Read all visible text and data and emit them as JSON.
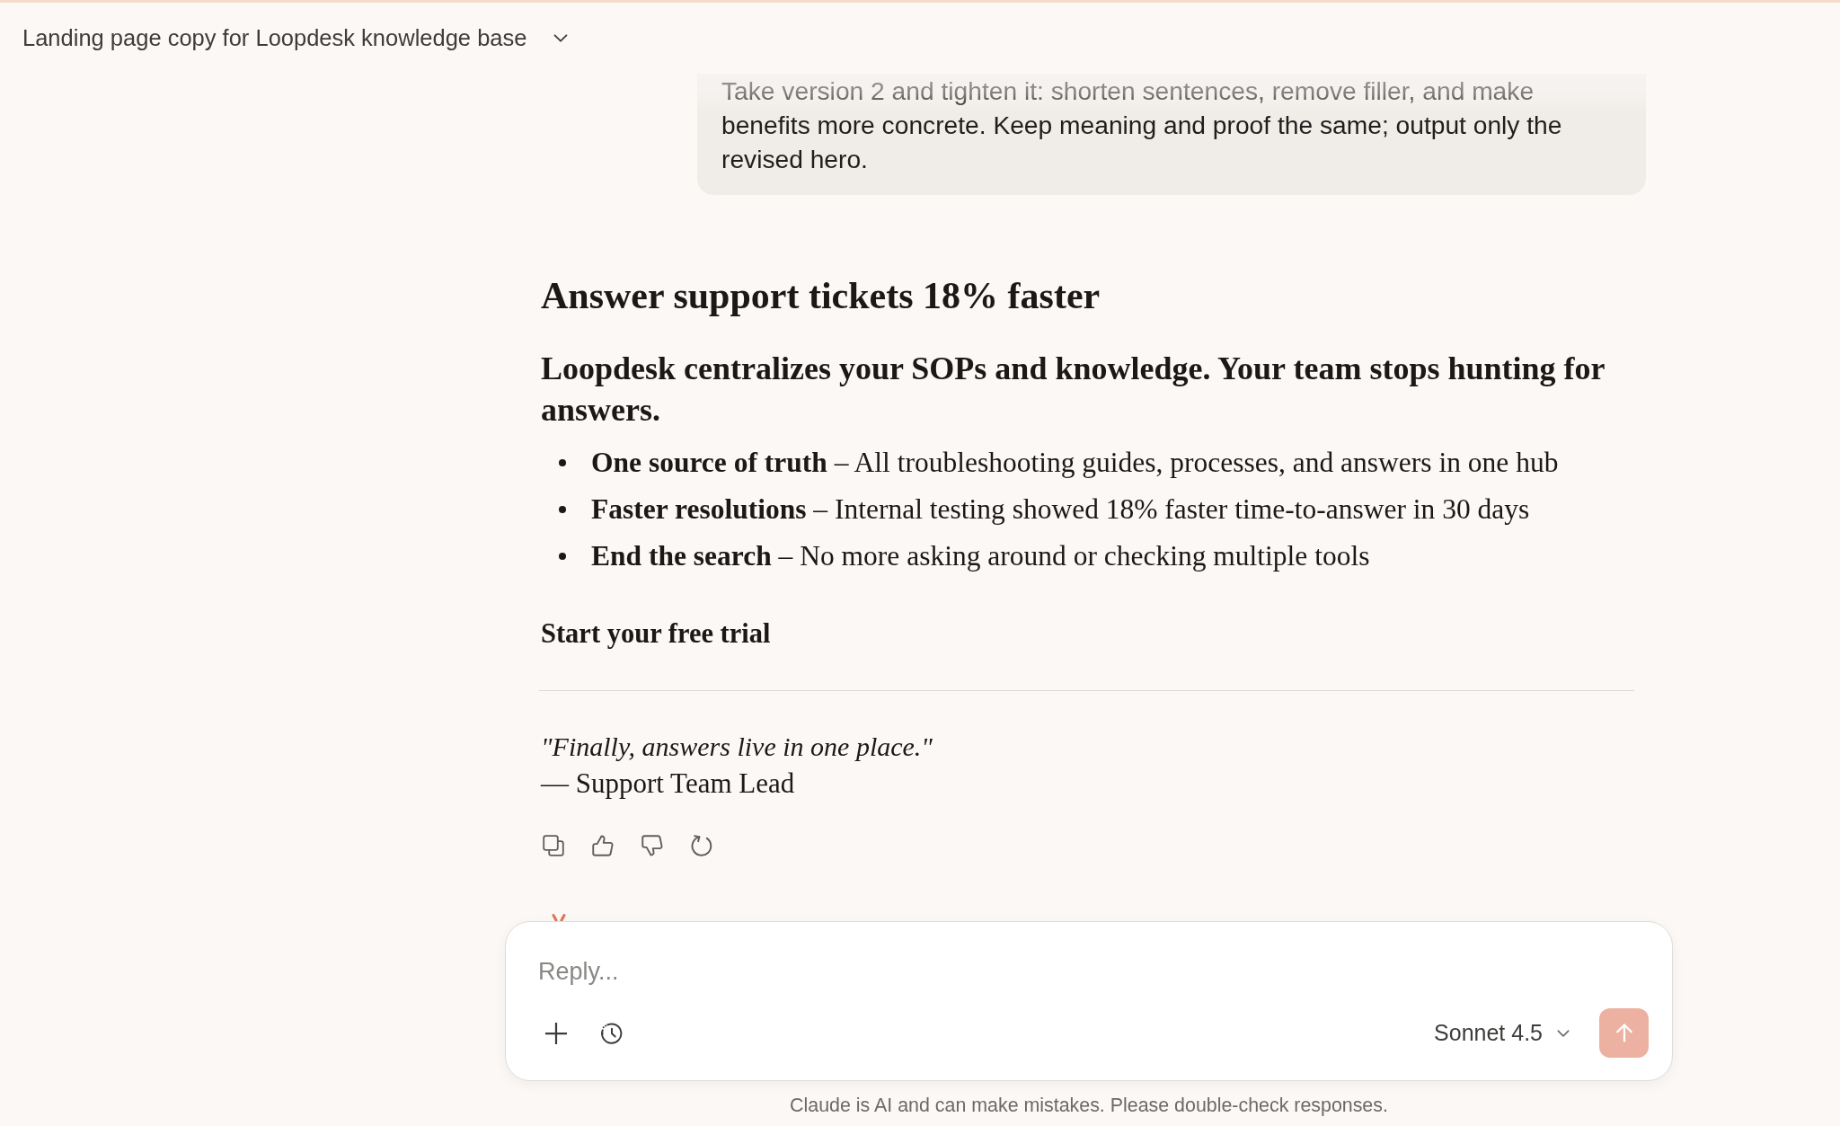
{
  "header": {
    "title": "Landing page copy for Loopdesk knowledge base"
  },
  "user_message": {
    "text": "Take version 2 and tighten it: shorten sentences, remove filler, and make benefits more concrete. Keep meaning and proof the same; output only the revised hero."
  },
  "response": {
    "heading": "Answer support tickets 18% faster",
    "subheading": "Loopdesk centralizes your SOPs and knowledge. Your team stops hunting for answers.",
    "bullets": [
      "**One source of truth** – All troubleshooting guides, processes, and answers in one hub",
      "**Faster resolutions** – Internal testing showed 18% faster time-to-answer in 30 days",
      "**End the search** – No more asking around or checking multiple tools"
    ],
    "cta": "Start your free trial",
    "quote": "\"Finally, answers live in one place.\"",
    "attribution": "— Support Team Lead"
  },
  "composer": {
    "placeholder": "Reply...",
    "model": "Sonnet 4.5"
  },
  "disclaimer": "Claude is AI and can make mistakes. Please double-check responses."
}
